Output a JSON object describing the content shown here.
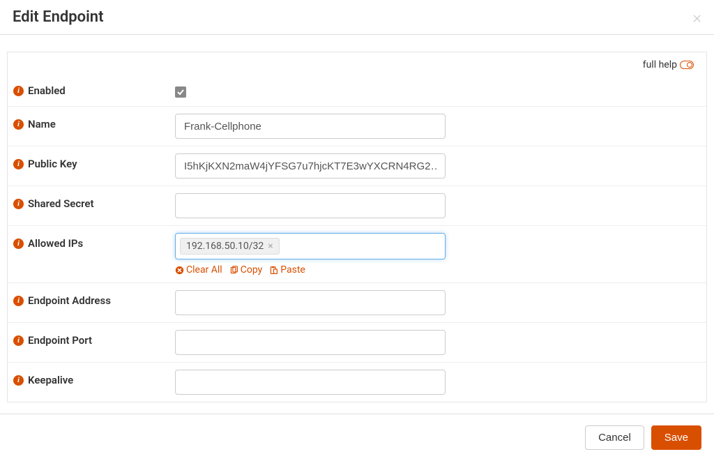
{
  "header": {
    "title": "Edit Endpoint"
  },
  "help": {
    "label": "full help"
  },
  "fields": {
    "enabled": {
      "label": "Enabled",
      "checked": true
    },
    "name": {
      "label": "Name",
      "value": "Frank-Cellphone"
    },
    "publicKey": {
      "label": "Public Key",
      "value": "I5hKjKXN2maW4jYFSG7u7hjcKT7E3wYXCRN4RG2…"
    },
    "sharedSecret": {
      "label": "Shared Secret",
      "value": ""
    },
    "allowedIps": {
      "label": "Allowed IPs",
      "tags": [
        "192.168.50.10/32"
      ],
      "actions": {
        "clearAll": "Clear All",
        "copy": "Copy",
        "paste": "Paste"
      }
    },
    "endpointAddress": {
      "label": "Endpoint Address",
      "value": ""
    },
    "endpointPort": {
      "label": "Endpoint Port",
      "value": ""
    },
    "keepalive": {
      "label": "Keepalive",
      "value": ""
    }
  },
  "footer": {
    "cancel": "Cancel",
    "save": "Save"
  }
}
